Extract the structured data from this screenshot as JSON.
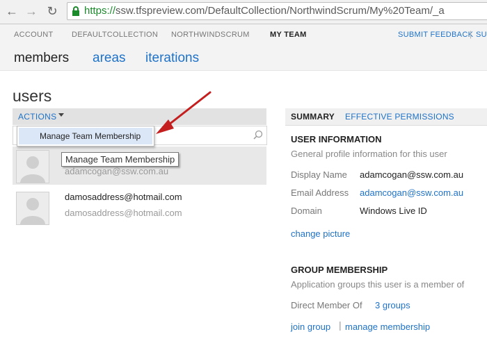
{
  "browser": {
    "url_scheme": "https://",
    "url_rest": "ssw.tfspreview.com/DefaultCollection/NorthwindScrum/My%20Team/_a"
  },
  "top_nav": {
    "items": [
      "ACCOUNT",
      "DEFAULTCOLLECTION",
      "NORTHWINDSCRUM",
      "MY TEAM"
    ],
    "submit_feedback": "SUBMIT FEEDBACK",
    "cut_link": "SU"
  },
  "hubs": [
    "members",
    "areas",
    "iterations"
  ],
  "users": {
    "title": "users",
    "actions_label": "ACTIONS",
    "menu_item": "Manage Team Membership",
    "tooltip": "Manage Team Membership",
    "list": [
      {
        "name": "",
        "email": "adamcogan@ssw.com.au"
      },
      {
        "name": "damosaddress@hotmail.com",
        "email": "damosaddress@hotmail.com"
      }
    ]
  },
  "summary": {
    "tabs": [
      "SUMMARY",
      "EFFECTIVE PERMISSIONS"
    ],
    "user_info": {
      "heading": "USER INFORMATION",
      "description": "General profile information for this user",
      "fields": [
        {
          "label": "Display Name",
          "value": "adamcogan@ssw.com.au"
        },
        {
          "label": "Email Address",
          "value": "adamcogan@ssw.com.au"
        },
        {
          "label": "Domain",
          "value": "Windows Live ID"
        }
      ],
      "change_picture": "change picture"
    },
    "group_membership": {
      "heading": "GROUP MEMBERSHIP",
      "description": "Application groups this user is a member of",
      "direct_member_label": "Direct Member Of",
      "groups_link": "3 groups",
      "join_group": "join group",
      "manage_membership": "manage membership"
    }
  },
  "colors": {
    "link": "#1e72c8",
    "https_green": "#1a8a2b",
    "annotation_arrow": "#c41e1e"
  }
}
